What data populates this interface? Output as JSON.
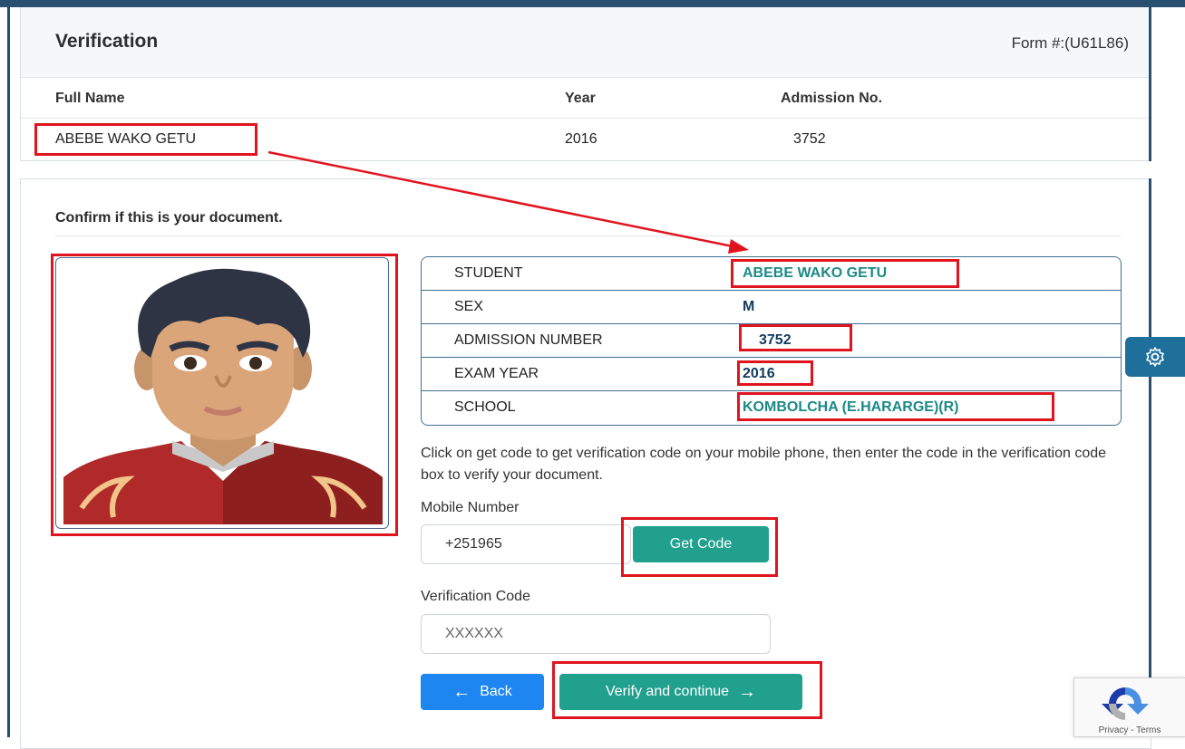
{
  "header": {
    "title": "Verification",
    "form_number": "Form #:(U61L86)"
  },
  "summary_table": {
    "columns": [
      "Full Name",
      "Year",
      "Admission No."
    ],
    "row": [
      "ABEBE WAKO GETU",
      "2016",
      "3752"
    ]
  },
  "document": {
    "prompt": "Confirm if this is your document.",
    "fields": [
      {
        "label": "STUDENT",
        "value": "ABEBE WAKO GETU"
      },
      {
        "label": "SEX",
        "value": "M"
      },
      {
        "label": "ADMISSION NUMBER",
        "value": "3752"
      },
      {
        "label": "EXAM YEAR",
        "value": "2016"
      },
      {
        "label": "SCHOOL",
        "value": "KOMBOLCHA (E.HARARGE)(R)"
      }
    ]
  },
  "verification": {
    "instructions": "Click on get code to get verification code on your mobile phone, then enter the code in the verification code box to verify your document.",
    "mobile_label": "Mobile Number",
    "mobile_value": "+251965",
    "get_code_label": "Get Code",
    "code_label": "Verification Code",
    "code_placeholder": "XXXXXX",
    "back_label": "Back",
    "verify_label": "Verify and continue"
  },
  "settings": {
    "icon": "gear-icon"
  },
  "recaptcha": {
    "footer": "Privacy - Terms"
  },
  "colors": {
    "teal": "#21a08e",
    "blue": "#1e86f0",
    "annotation_red": "#e0141f",
    "frame_navy": "#2a5070"
  }
}
